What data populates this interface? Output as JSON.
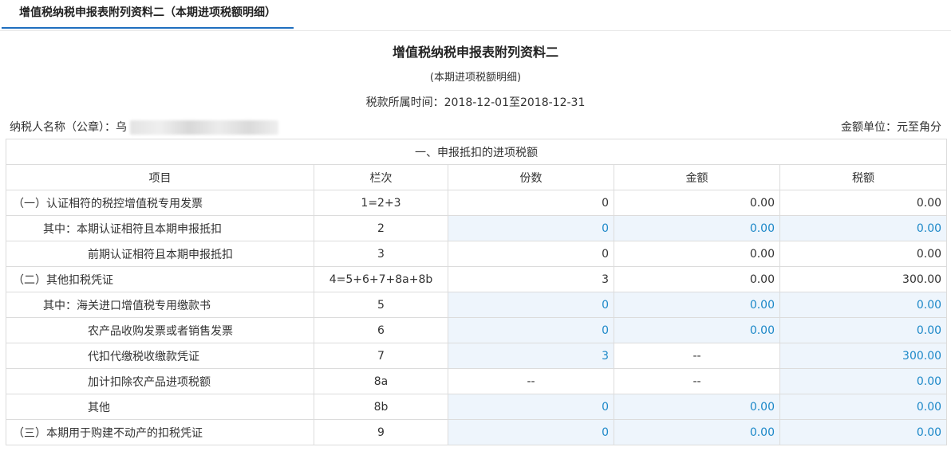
{
  "tab": {
    "label": "增值税纳税申报表附列资料二（本期进项税额明细）"
  },
  "header": {
    "title": "增值税纳税申报表附列资料二",
    "subtitle": "(本期进项税额明细)",
    "period_label": "税款所属时间：",
    "period_value": "2018-12-01至2018-12-31",
    "taxpayer_label": "纳税人名称（公章）：",
    "taxpayer_name_visible": "乌",
    "unit_label": "金额单位：元至角分"
  },
  "table": {
    "section_title": "一、申报抵扣的进项税额",
    "columns": [
      "项目",
      "栏次",
      "份数",
      "金额",
      "税额"
    ],
    "rows": [
      {
        "item": "（一）认证相符的税控增值税专用发票",
        "line": "1=2+3",
        "count": "0",
        "amount": "0.00",
        "tax": "0.00"
      },
      {
        "item": "其中：本期认证相符且本期申报抵扣",
        "line": "2",
        "count": "0",
        "amount": "0.00",
        "tax": "0.00"
      },
      {
        "item": "前期认证相符且本期申报抵扣",
        "line": "3",
        "count": "0",
        "amount": "0.00",
        "tax": "0.00"
      },
      {
        "item": "（二）其他扣税凭证",
        "line": "4=5+6+7+8a+8b",
        "count": "3",
        "amount": "0.00",
        "tax": "300.00"
      },
      {
        "item": "其中：海关进口增值税专用缴款书",
        "line": "5",
        "count": "0",
        "amount": "0.00",
        "tax": "0.00"
      },
      {
        "item": "农产品收购发票或者销售发票",
        "line": "6",
        "count": "0",
        "amount": "0.00",
        "tax": "0.00"
      },
      {
        "item": "代扣代缴税收缴款凭证",
        "line": "7",
        "count": "3",
        "amount": "--",
        "tax": "300.00"
      },
      {
        "item": "加计扣除农产品进项税额",
        "line": "8a",
        "count": "--",
        "amount": "--",
        "tax": "0.00"
      },
      {
        "item": "其他",
        "line": "8b",
        "count": "0",
        "amount": "0.00",
        "tax": "0.00"
      },
      {
        "item": "（三）本期用于购建不动产的扣税凭证",
        "line": "9",
        "count": "0",
        "amount": "0.00",
        "tax": "0.00"
      }
    ]
  },
  "colors": {
    "accent": "#1f6fbf",
    "editable_bg": "#eef5fc",
    "editable_text": "#1c88c8"
  }
}
